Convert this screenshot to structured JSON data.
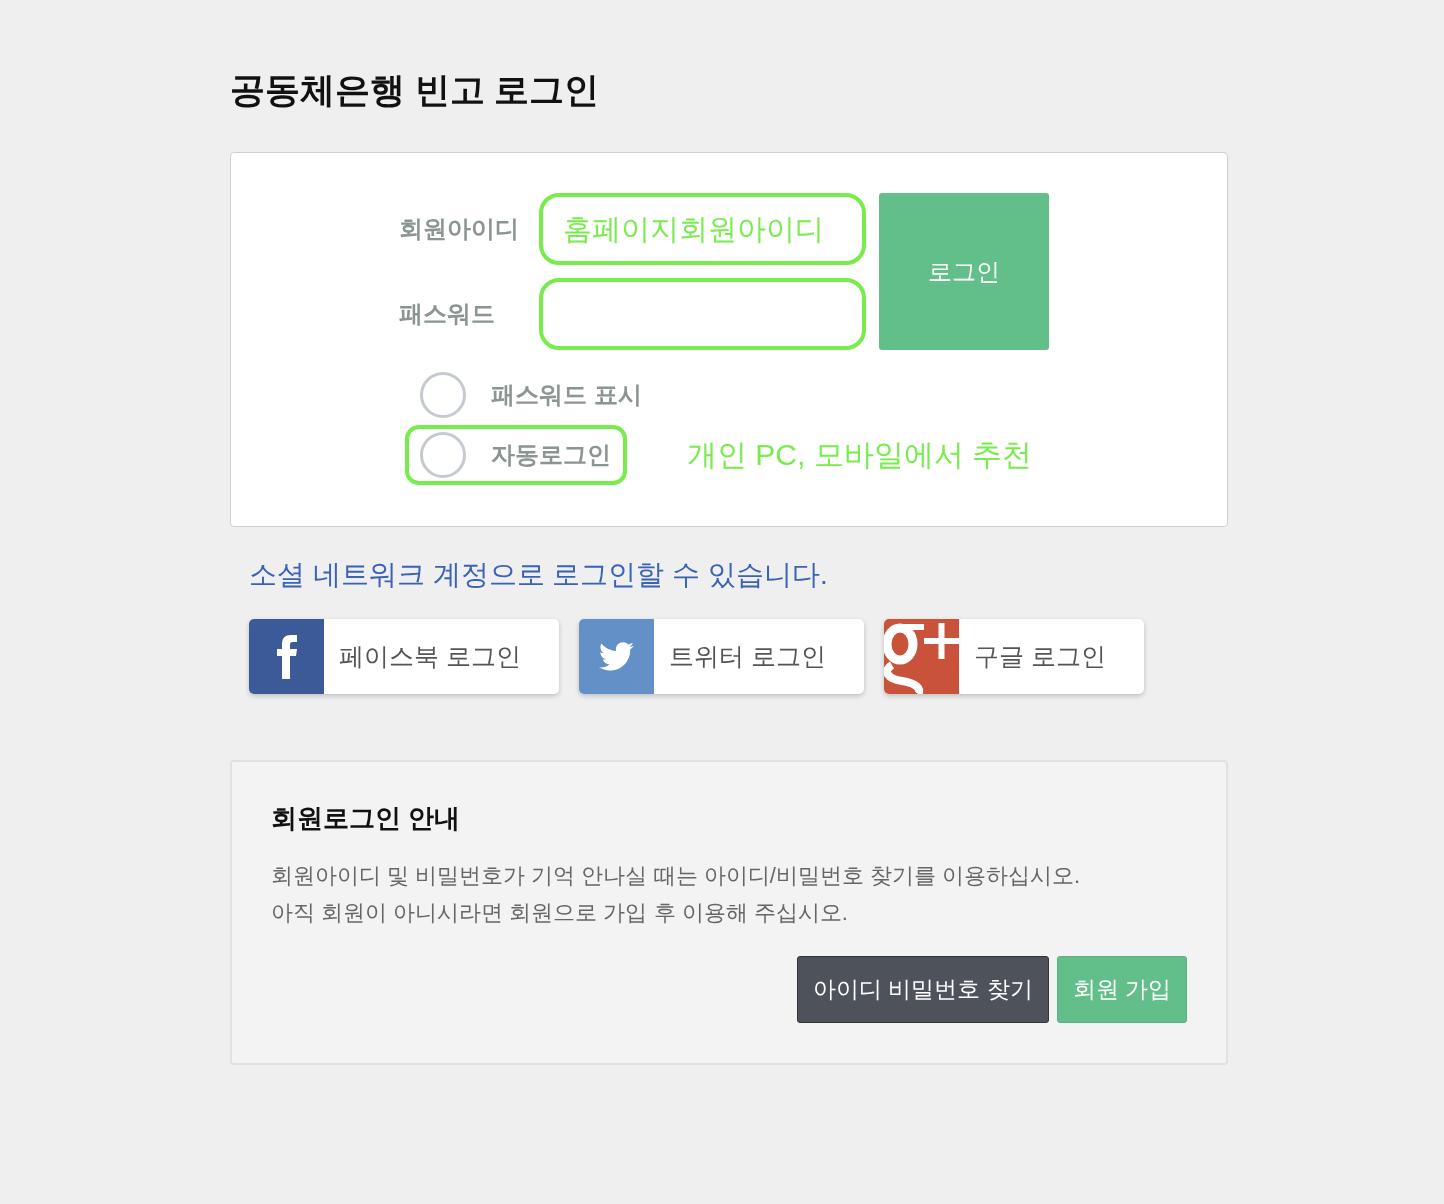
{
  "title": "공동체은행 빈고 로그인",
  "login": {
    "fields": [
      {
        "label": "회원아이디",
        "placeholder": "홈페이지회원아이디",
        "highlighted": true
      },
      {
        "label": "패스워드",
        "highlighted": true
      }
    ],
    "submit": "로그인",
    "options": [
      {
        "label": "패스워드 표시",
        "checked": false,
        "highlighted": false
      },
      {
        "label": "자동로그인",
        "checked": false,
        "highlighted": true,
        "note": "개인 PC, 모바일에서 추천"
      }
    ]
  },
  "social": {
    "heading": "소셜 네트워크 계정으로 로그인할 수 있습니다.",
    "buttons": [
      {
        "kind": "facebook",
        "label": "페이스북 로그인"
      },
      {
        "kind": "twitter",
        "label": "트위터 로그인"
      },
      {
        "kind": "google",
        "label": "구글 로그인"
      }
    ]
  },
  "info": {
    "title": "회원로그인 안내",
    "lines": [
      "회원아이디 및 비밀번호가 기억 안나실 때는 아이디/비밀번호 찾기를 이용하십시오.",
      "아직 회원이 아니시라면 회원으로 가입 후 이용해 주십시오."
    ],
    "buttons": [
      {
        "kind": "secondary",
        "label": "아이디 비밀번호 찾기"
      },
      {
        "kind": "primary",
        "label": "회원 가입"
      }
    ]
  }
}
